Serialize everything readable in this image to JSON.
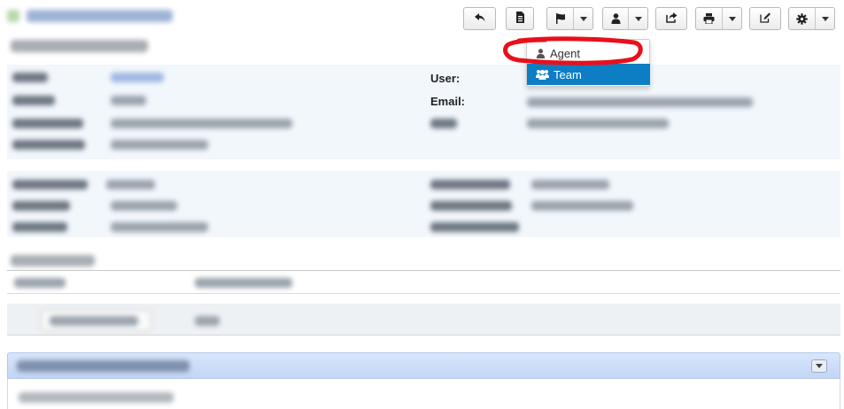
{
  "toolbar": {
    "buttons": [
      {
        "name": "back-button",
        "icon": "reply-icon"
      },
      {
        "name": "document-button",
        "icon": "document-icon"
      },
      {
        "name": "flag-button",
        "icon": "flag-icon",
        "has_caret": true
      },
      {
        "name": "person-button",
        "icon": "user-icon",
        "has_caret": true
      },
      {
        "name": "share-button",
        "icon": "share-icon"
      },
      {
        "name": "print-button",
        "icon": "print-icon",
        "has_caret": true
      },
      {
        "name": "edit-button",
        "icon": "edit-icon"
      },
      {
        "name": "settings-button",
        "icon": "gear-icon",
        "has_caret": true
      }
    ]
  },
  "dropdown": {
    "items": [
      {
        "label": "Agent",
        "icon": "user-icon"
      },
      {
        "label": "Team",
        "icon": "users-icon",
        "selected": true
      }
    ]
  },
  "fields": {
    "user_label": "User:",
    "email_label": "Email:"
  },
  "colors": {
    "accent": "#0d7dc4",
    "annotation": "#e8101a",
    "panel": "#f2f7fc",
    "header_bar": "#c6d8f5"
  }
}
